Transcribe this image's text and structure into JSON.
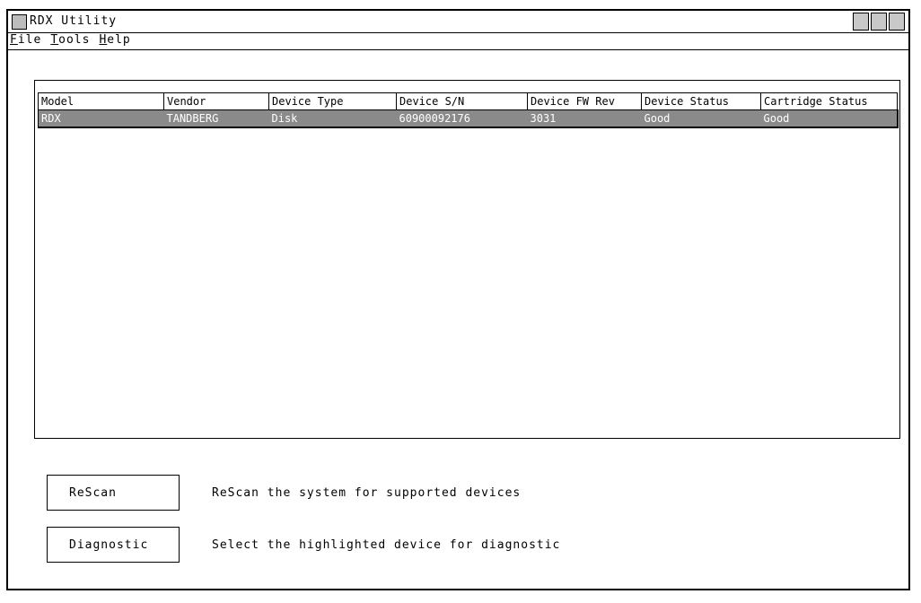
{
  "window": {
    "title": "RDX Utility"
  },
  "menu": [
    {
      "underline": "F",
      "rest": "ile"
    },
    {
      "underline": "T",
      "rest": "ools"
    },
    {
      "underline": "H",
      "rest": "elp"
    }
  ],
  "table": {
    "columns": [
      "Model",
      "Vendor",
      "Device Type",
      "Device S/N",
      "Device FW Rev",
      "Device Status",
      "Cartridge Status"
    ],
    "rows": [
      [
        "RDX",
        "TANDBERG",
        "Disk",
        "60900092176",
        "3031",
        "Good",
        "Good"
      ]
    ],
    "selected_row": 0
  },
  "actions": {
    "rescan": {
      "label": "ReScan",
      "description": "ReScan the system for supported devices"
    },
    "diagnostic": {
      "label": "Diagnostic",
      "description": "Select the highlighted device for diagnostic"
    }
  },
  "colors": {
    "selection": "#8a8a8a",
    "control": "#c8c8c8"
  }
}
